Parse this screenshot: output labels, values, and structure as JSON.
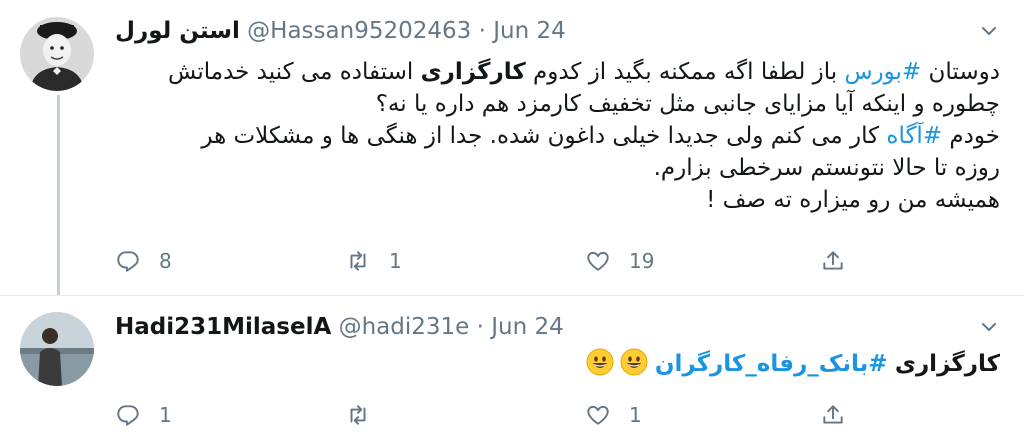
{
  "colors": {
    "link": "#1b95e0",
    "muted": "#657786",
    "text": "#14171a",
    "divider": "#e6ecf0"
  },
  "tweet1": {
    "name": "استن لورل",
    "handle": "@Hassan95202463",
    "separator": "·",
    "date": "Jun 24",
    "line1_a": "دوستان ",
    "line1_tag": "#بورس",
    "line1_b": " باز لطفا اگه ممکنه بگید از کدوم ",
    "line1_bold": "کارگزاری",
    "line1_c": " استفاده می کنید خدماتش",
    "line2": "چطوره و اینکه آیا مزایای جانبی مثل تخفیف کارمزد هم داره یا نه؟",
    "line3_a": "خودم ",
    "line3_tag": "#آگاه",
    "line3_b": " کار می کنم ولی جدیدا خیلی داغون شده. جدا از هنگی ها و مشکلات هر",
    "line4": "روزه تا حالا نتونستم سرخطی بزارم.",
    "line5": "همیشه من رو میزاره ته صف !",
    "reply_count": "8",
    "retweet_count": "1",
    "like_count": "19",
    "avatar_icon": "person-avatar-icon"
  },
  "tweet2": {
    "name": "Hadi231MilaselA",
    "handle": "@hadi231e",
    "separator": "·",
    "date": "Jun 24",
    "text_bold": "کارگزاری",
    "text_tag": "#بانک_رفاه_کارگران",
    "emoji_icon": "grinning-face-emoji",
    "reply_count": "1",
    "retweet_count": "",
    "like_count": "1",
    "avatar_icon": "person-avatar-icon"
  }
}
